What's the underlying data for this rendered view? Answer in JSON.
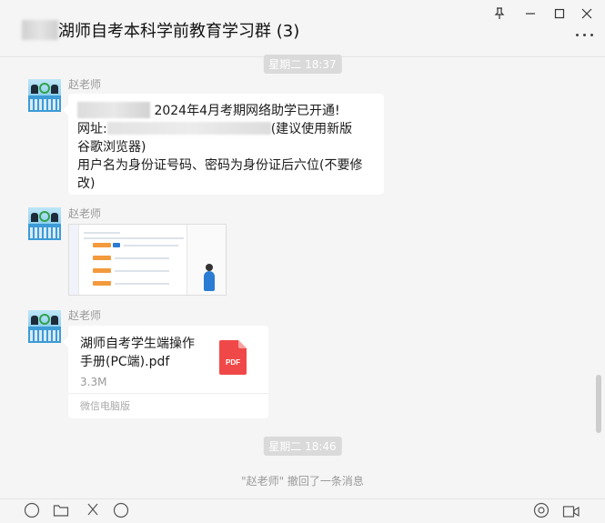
{
  "header": {
    "chat_title": "湖师自考本科学前教育学习群 (3)"
  },
  "window_controls": {
    "pin_icon": "pin-icon",
    "minimize_icon": "minimize-icon",
    "maximize_icon": "maximize-icon",
    "close_icon": "close-icon",
    "more_icon": "more-icon"
  },
  "messages": [
    {
      "timestamp": "星期二 18:37",
      "sender": "赵老师",
      "line1_suffix": "2024年4月考期网络助学已开通!",
      "line2_prefix": "网址:",
      "line2_suffix": "(建议使用新版",
      "line3": "谷歌浏览器)",
      "line4": "用户名为身份证号码、密码为身份证后六位(不要修",
      "line5": "改)"
    },
    {
      "sender": "赵老师",
      "type": "image"
    },
    {
      "sender": "赵老师",
      "file_name": "湖师自考学生端操作手册(PC端).pdf",
      "file_size": "3.3M",
      "file_icon_label": "PDF",
      "source": "微信电脑版"
    }
  ],
  "timestamp2": "星期二 18:46",
  "recall_notice": "\"赵老师\" 撤回了一条消息",
  "colors": {
    "pdf_red": "#f04848",
    "background": "#f5f5f5",
    "bubble": "#ffffff"
  }
}
